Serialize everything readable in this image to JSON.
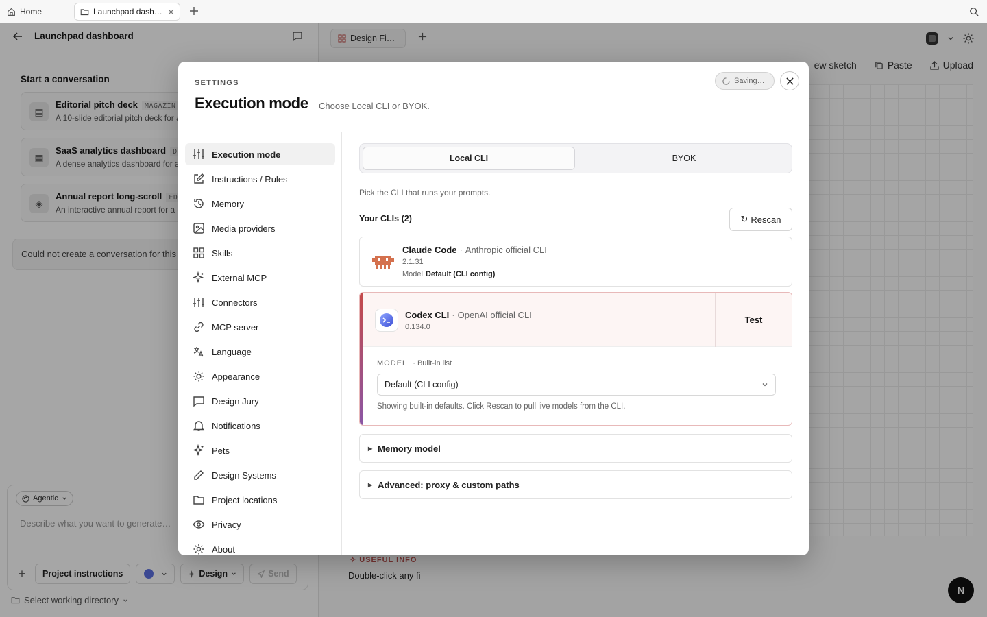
{
  "browser": {
    "home_label": "Home",
    "tab_label": "Launchpad dash…"
  },
  "left_panel": {
    "title": "Launchpad dashboard",
    "section_title": "Start a conversation",
    "cards": [
      {
        "title": "Editorial pitch deck",
        "tag": "MAGAZIN",
        "desc": "A 10-slide editorial pitch deck for a",
        "icon": "layout-icon"
      },
      {
        "title": "SaaS analytics dashboard",
        "tag": "D",
        "desc": "A dense analytics dashboard for a",
        "icon": "grid-icon"
      },
      {
        "title": "Annual report long-scroll",
        "tag": "ED",
        "desc": "An interactive annual report for a c",
        "icon": "diamond-icon"
      }
    ],
    "error_text": "Could not create a conversation for this",
    "composer": {
      "mode_label": "Agentic",
      "placeholder": "Describe what you want to generate…",
      "project_instructions": "Project instructions",
      "design_label": "Design",
      "send_label": "Send"
    },
    "working_dir": "Select working directory"
  },
  "right_pane": {
    "tab_label": "Design Fi…",
    "toolbar": {
      "sketch": "ew sketch",
      "paste": "Paste",
      "upload": "Upload"
    },
    "useful_info_label": "USEFUL INFO",
    "useful_info_text": "Double-click any fi",
    "badge": "N"
  },
  "modal": {
    "kicker": "SETTINGS",
    "title": "Execution mode",
    "subtitle": "Choose Local CLI or BYOK.",
    "saving": "Saving…",
    "nav": [
      {
        "label": "Execution mode",
        "icon": "sliders-icon",
        "active": true
      },
      {
        "label": "Instructions / Rules",
        "icon": "edit-icon"
      },
      {
        "label": "Memory",
        "icon": "history-icon"
      },
      {
        "label": "Media providers",
        "icon": "image-icon"
      },
      {
        "label": "Skills",
        "icon": "grid-icon"
      },
      {
        "label": "External MCP",
        "icon": "sparkle-icon"
      },
      {
        "label": "Connectors",
        "icon": "sliders-icon"
      },
      {
        "label": "MCP server",
        "icon": "link-icon"
      },
      {
        "label": "Language",
        "icon": "translate-icon"
      },
      {
        "label": "Appearance",
        "icon": "sun-icon"
      },
      {
        "label": "Design Jury",
        "icon": "message-icon"
      },
      {
        "label": "Notifications",
        "icon": "bell-icon"
      },
      {
        "label": "Pets",
        "icon": "sparkle-icon"
      },
      {
        "label": "Design Systems",
        "icon": "pen-icon"
      },
      {
        "label": "Project locations",
        "icon": "folder-icon"
      },
      {
        "label": "Privacy",
        "icon": "eye-icon"
      },
      {
        "label": "About",
        "icon": "gear-icon"
      }
    ],
    "segment": {
      "local": "Local CLI",
      "byok": "BYOK"
    },
    "hint": "Pick the CLI that runs your prompts.",
    "clis_heading": "Your CLIs (2)",
    "rescan": "Rescan",
    "cli_claude": {
      "name": "Claude Code",
      "by": "Anthropic official CLI",
      "version": "2.1.31",
      "model_label": "Model",
      "model_value": "Default (CLI config)"
    },
    "cli_codex": {
      "name": "Codex CLI",
      "by": "OpenAI official CLI",
      "version": "0.134.0",
      "test": "Test",
      "model_label": "MODEL",
      "model_source": "· Built-in list",
      "model_value": "Default (CLI config)",
      "note": "Showing built-in defaults. Click Rescan to pull live models from the CLI."
    },
    "accordions": {
      "memory": "Memory model",
      "advanced": "Advanced: proxy & custom paths"
    }
  }
}
